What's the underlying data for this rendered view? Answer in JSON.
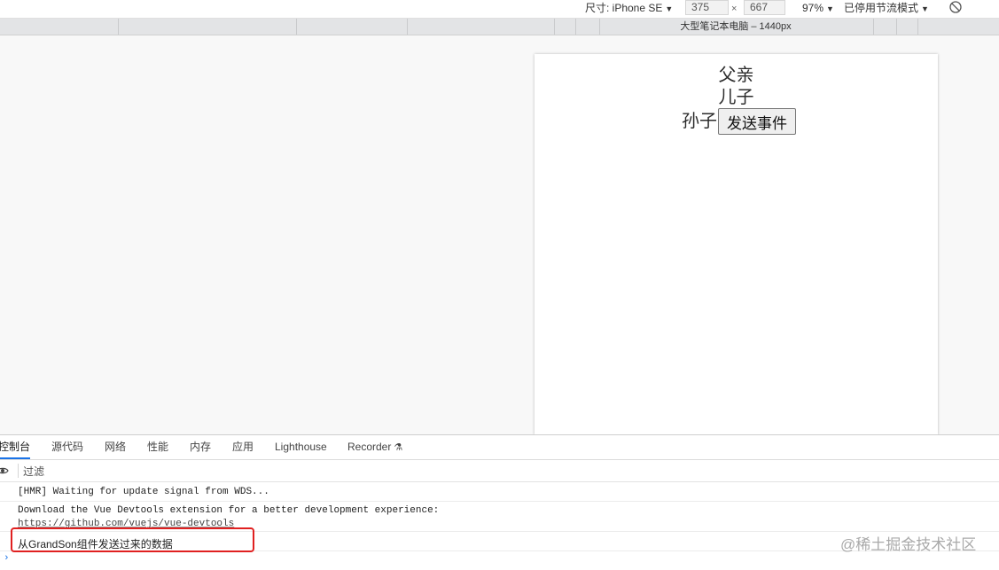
{
  "device_toolbar": {
    "dimensions_label": "尺寸: iPhone SE",
    "width": "375",
    "times": "×",
    "height": "667",
    "zoom": "97%",
    "throttling": "已停用节流模式",
    "caret": "▼"
  },
  "media_query_bar": {
    "label": "大型笔记本电脑 – 1440px"
  },
  "page": {
    "father": "父亲",
    "son": "儿子",
    "grandson": "孙子",
    "send_button": "发送事件"
  },
  "devtools": {
    "tabs": [
      {
        "label": "控制台"
      },
      {
        "label": "源代码"
      },
      {
        "label": "网络"
      },
      {
        "label": "性能"
      },
      {
        "label": "内存"
      },
      {
        "label": "应用"
      },
      {
        "label": "Lighthouse"
      },
      {
        "label": "Recorder"
      }
    ],
    "filter_placeholder": "过滤"
  },
  "console": {
    "messages": [
      {
        "text": "[HMR] Waiting for update signal from WDS..."
      },
      {
        "text": "Download the Vue Devtools extension for a better development experience:",
        "link": "https://github.com/vuejs/vue-devtools"
      },
      {
        "text": "从GrandSon组件发送过来的数据"
      }
    ],
    "prompt": "›"
  },
  "watermark": "@稀土掘金技术社区",
  "colors": {
    "accent": "#1a73e8",
    "highlight_border": "#e02020"
  }
}
